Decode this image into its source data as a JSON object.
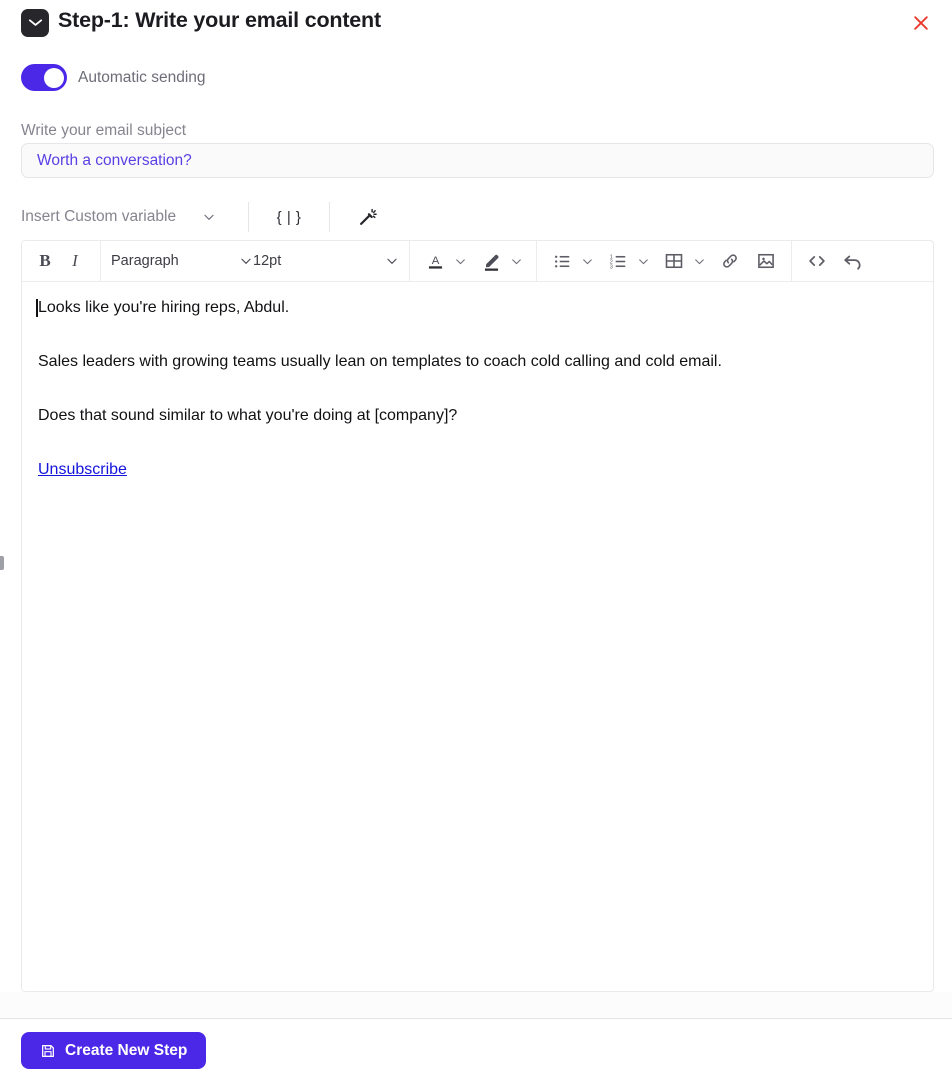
{
  "header": {
    "icon": "mail-icon",
    "title": "Step-1:  Write your email content",
    "close_icon": "close-icon",
    "close_color": "#e8392c"
  },
  "automatic_sending": {
    "label": "Automatic sending",
    "enabled": true,
    "accent_color": "#4b28e8"
  },
  "subject": {
    "label": "Write your email subject",
    "value": "Worth a conversation?",
    "placeholder": "Write your email subject",
    "text_color": "#5b3fe4"
  },
  "variable_bar": {
    "select_label": "Insert Custom variable",
    "chevron_icon": "chevron-down-icon",
    "braces_label": "{ | }",
    "braces_icon": "curly-braces-icon",
    "wand_icon": "magic-wand-icon"
  },
  "toolbar": {
    "bold_label": "B",
    "italic_label": "I",
    "block_format": "Paragraph",
    "font_size": "12pt",
    "items": [
      {
        "name": "bold-button",
        "label": "B"
      },
      {
        "name": "italic-button",
        "label": "I"
      },
      {
        "name": "block-format-select",
        "label": "Paragraph"
      },
      {
        "name": "font-size-select",
        "label": "12pt"
      },
      {
        "name": "text-color-button",
        "label": "A"
      },
      {
        "name": "highlight-color-button",
        "label": ""
      },
      {
        "name": "bullet-list-button",
        "label": ""
      },
      {
        "name": "numbered-list-button",
        "label": ""
      },
      {
        "name": "table-button",
        "label": ""
      },
      {
        "name": "link-button",
        "label": ""
      },
      {
        "name": "image-button",
        "label": ""
      },
      {
        "name": "source-code-button",
        "label": "<>"
      },
      {
        "name": "undo-button",
        "label": ""
      }
    ]
  },
  "email_body": {
    "paragraph_1": "Looks like you're hiring reps, Abdul.",
    "paragraph_2": "Sales leaders with growing teams usually lean on templates to coach cold calling and cold email.",
    "paragraph_3": "Does that sound similar to what you're doing at [company]?",
    "unsubscribe_label": "Unsubscribe",
    "link_color": "#1414dd"
  },
  "footer": {
    "create_label": "Create New Step",
    "create_icon": "save-icon",
    "button_color": "#4b28e8"
  }
}
